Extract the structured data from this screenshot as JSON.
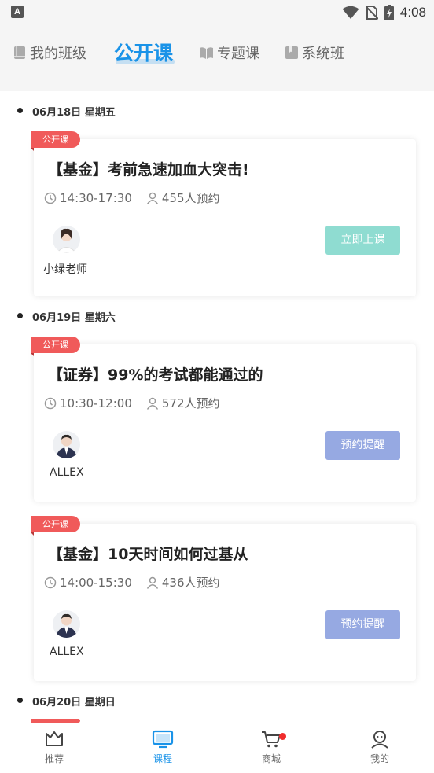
{
  "status_bar": {
    "app_icon": "A",
    "time": "4:08",
    "icons": [
      "wifi-icon",
      "no-sim-icon",
      "battery-charging-icon"
    ]
  },
  "tabs": [
    {
      "label": "我的班级",
      "icon": "book-icon",
      "active": false
    },
    {
      "label": "公开课",
      "icon": "",
      "active": true
    },
    {
      "label": "专题课",
      "icon": "open-book-icon",
      "active": false
    },
    {
      "label": "系统班",
      "icon": "bookmark-book-icon",
      "active": false
    }
  ],
  "colors": {
    "accent": "#1a93e8",
    "badge": "#f05a5a",
    "btn_green": "#8fdcd1",
    "btn_blue": "#96a9e2",
    "nav_dot": "#f02c2c"
  },
  "dates": [
    "06月18日 星期五",
    "06月19日 星期六",
    "06月20日 星期日"
  ],
  "courses": [
    {
      "badge": "公开课",
      "title": "【基金】考前急速加血大突击!",
      "time": "14:30-17:30",
      "booked": "455人预约",
      "teacher": "小绿老师",
      "action": "立即上课"
    },
    {
      "badge": "公开课",
      "title": "【证券】99%的考试都能通过的",
      "time": "10:30-12:00",
      "booked": "572人预约",
      "teacher": "ALLEX",
      "action": "预约提醒"
    },
    {
      "badge": "公开课",
      "title": "【基金】10天时间如何过基从",
      "time": "14:00-15:30",
      "booked": "436人预约",
      "teacher": "ALLEX",
      "action": "预约提醒"
    }
  ],
  "bottom_nav": [
    {
      "label": "推荐",
      "icon": "crown-icon",
      "active": false
    },
    {
      "label": "课程",
      "icon": "tv-icon",
      "active": true
    },
    {
      "label": "商城",
      "icon": "cart-icon",
      "active": false,
      "has_dot": true
    },
    {
      "label": "我的",
      "icon": "user-icon",
      "active": false
    }
  ]
}
